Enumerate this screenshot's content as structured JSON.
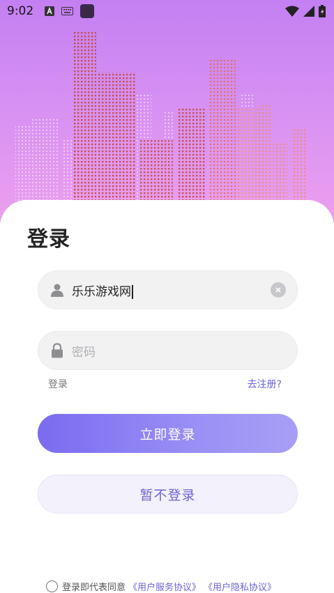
{
  "status_bar": {
    "time": "9:02"
  },
  "login": {
    "title": "登录",
    "username_value": "乐乐游戏网",
    "password_placeholder": "密码",
    "login_link": "登录",
    "register_link": "去注册?",
    "primary_button": "立即登录",
    "secondary_button": "暂不登录"
  },
  "agreement": {
    "text": "登录即代表同意",
    "service_link": "《用户服务协议》",
    "privacy_link": "《用户隐私协议》"
  },
  "colors": {
    "hero_top": "#c47ff2",
    "accent": "#7a6bf0",
    "link": "#6b63d6"
  },
  "icons": [
    "text-a-icon",
    "keyboard-icon",
    "app-square-icon",
    "wifi-icon",
    "signal-icon",
    "battery-icon",
    "user-icon",
    "lock-icon",
    "clear-icon"
  ]
}
